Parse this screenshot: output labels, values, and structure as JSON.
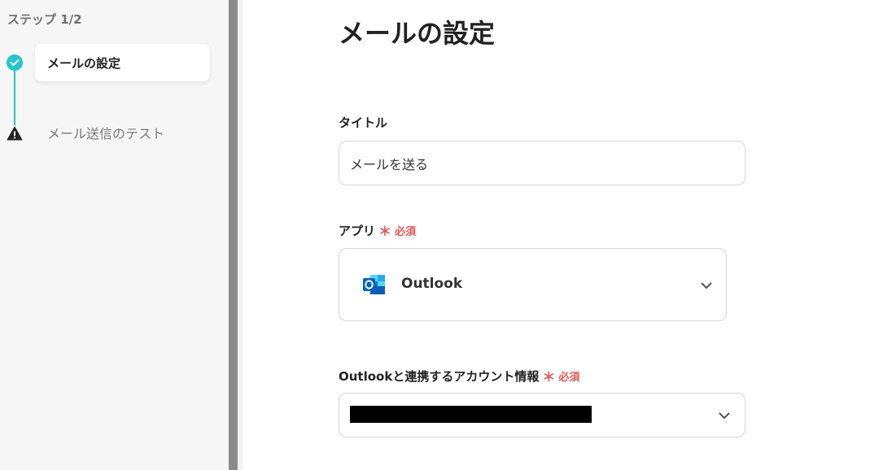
{
  "sidebar": {
    "step_counter": "ステップ 1/2",
    "steps": [
      {
        "label": "メールの設定",
        "status": "done"
      },
      {
        "label": "メール送信のテスト",
        "status": "warning"
      }
    ],
    "accent_color": "#26c4cf"
  },
  "main": {
    "title": "メールの設定",
    "title_field": {
      "label": "タイトル",
      "value": "メールを送る"
    },
    "app_field": {
      "label": "アプリ",
      "required_mark": "＊",
      "required_text": "必須",
      "selected_app": "Outlook",
      "app_icon": "outlook-icon"
    },
    "account_field": {
      "label": "Outlookと連携するアカウント情報",
      "required_mark": "＊",
      "required_text": "必須"
    },
    "required_color": "#e35555"
  }
}
